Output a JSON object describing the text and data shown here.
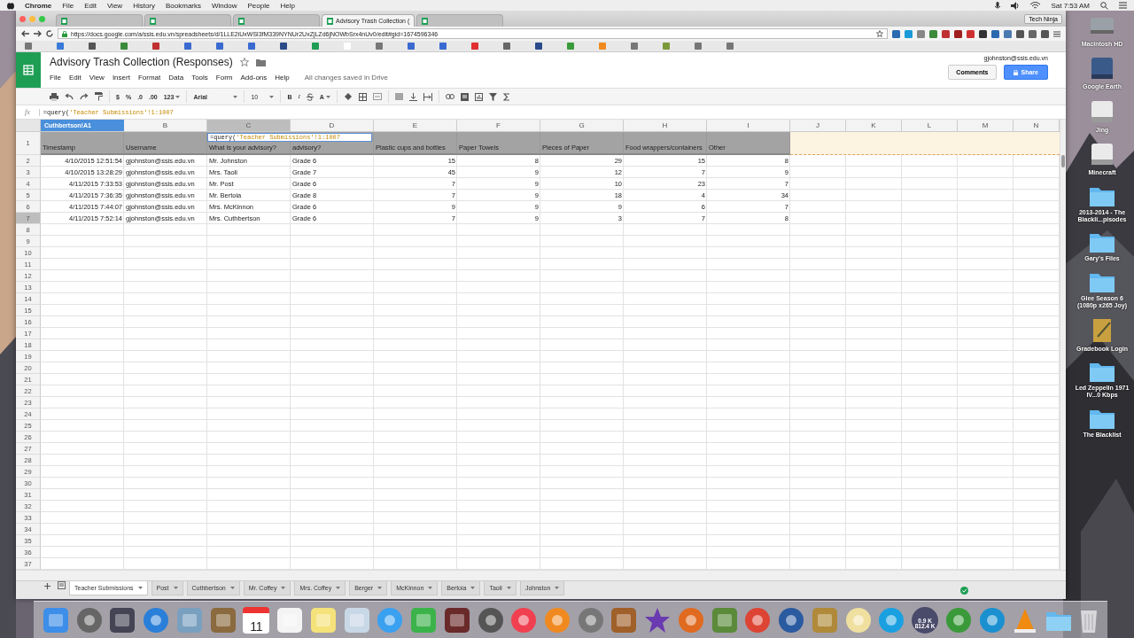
{
  "menubar": {
    "app": "Chrome",
    "menus": [
      "File",
      "Edit",
      "View",
      "History",
      "Bookmarks",
      "Window",
      "People",
      "Help"
    ],
    "clock": "Sat 7:53 AM"
  },
  "browser": {
    "tabs": [
      {
        "selected": false
      },
      {
        "selected": false
      },
      {
        "selected": false
      },
      {
        "title": "Advisory Trash Collection (",
        "selected": true
      },
      {
        "selected": false
      }
    ],
    "profile": "Tech Ninja",
    "url": "https://docs.google.com/a/ssis.edu.vn/spreadsheets/d/1LLE2iUxWSl3fM339NYNUr2UxZjLZd6jNOWbSrx4nUv0/edit#gid=1674596346"
  },
  "doc": {
    "title": "Advisory Trash Collection (Responses)",
    "menus": [
      "File",
      "Edit",
      "View",
      "Insert",
      "Format",
      "Data",
      "Tools",
      "Form",
      "Add-ons",
      "Help"
    ],
    "save_status": "All changes saved in Drive",
    "user": "gjohnston@ssis.edu.vn",
    "comments_button": "Comments",
    "share_button": "Share"
  },
  "toolbar": {
    "currency": "$",
    "percent": "%",
    "decrease_decimals": ".0",
    "increase_decimals": ".00",
    "number_format": "123",
    "font": "Arial",
    "font_size": "10",
    "bold": "B",
    "italic": "I",
    "text_color": "A"
  },
  "formula_bar": {
    "label": "fx",
    "formula_start": "=query(",
    "formula_reference": "'Teacher Submissions'!1:1007"
  },
  "name_box": "Cuthbertson!A1",
  "cell_editor": {
    "formula_start": "=query(",
    "formula_reference": "'Teacher Submissions'!1:1007"
  },
  "columns": [
    {
      "letter": "B",
      "selected": false
    },
    {
      "letter": "C",
      "selected": true
    },
    {
      "letter": "D",
      "selected": false
    },
    {
      "letter": "E",
      "selected": false
    },
    {
      "letter": "F",
      "selected": false
    },
    {
      "letter": "G",
      "selected": false
    },
    {
      "letter": "H",
      "selected": false
    },
    {
      "letter": "I",
      "selected": false
    },
    {
      "letter": "J",
      "selected": false
    },
    {
      "letter": "K",
      "selected": false
    },
    {
      "letter": "L",
      "selected": false
    },
    {
      "letter": "M",
      "selected": false
    },
    {
      "letter": "N",
      "selected": false
    }
  ],
  "header_row": {
    "number": "1",
    "selected": false,
    "cells": [
      "Timestamp",
      "Username",
      "What is your advisory?",
      "advisory?",
      "Plastic cups and bottles",
      "Paper Towels",
      "Pieces of Paper",
      "Food wrappers/containers",
      "Other"
    ]
  },
  "rows": [
    {
      "number": "2",
      "selected": false,
      "cells": [
        "4/10/2015 12:51:54",
        "gjohnston@ssis.edu.vn",
        "Mr. Johnston",
        "Grade 6",
        "15",
        "8",
        "29",
        "15",
        "8"
      ]
    },
    {
      "number": "3",
      "selected": false,
      "cells": [
        "4/10/2015 13:28:29",
        "gjohnston@ssis.edu.vn",
        "Mrs. Taoli",
        "Grade 7",
        "45",
        "9",
        "12",
        "7",
        "9"
      ]
    },
    {
      "number": "4",
      "selected": false,
      "cells": [
        "4/11/2015 7:33:53",
        "gjohnston@ssis.edu.vn",
        "Mr. Post",
        "Grade 6",
        "7",
        "9",
        "10",
        "23",
        "7"
      ]
    },
    {
      "number": "5",
      "selected": false,
      "cells": [
        "4/11/2015 7:36:35",
        "gjohnston@ssis.edu.vn",
        "Mr. Bertoia",
        "Grade 8",
        "7",
        "9",
        "18",
        "4",
        "34"
      ]
    },
    {
      "number": "6",
      "selected": false,
      "cells": [
        "4/11/2015 7:44:07",
        "gjohnston@ssis.edu.vn",
        "Mrs. McKinnon",
        "Grade 6",
        "9",
        "9",
        "9",
        "6",
        "7"
      ]
    },
    {
      "number": "7",
      "selected": true,
      "cells": [
        "4/11/2015 7:52:14",
        "gjohnston@ssis.edu.vn",
        "Mrs. Cuthbertson",
        "Grade 6",
        "7",
        "9",
        "3",
        "7",
        "8"
      ]
    },
    {
      "number": "8",
      "selected": false
    },
    {
      "number": "9",
      "selected": false
    },
    {
      "number": "10",
      "selected": false
    },
    {
      "number": "11",
      "selected": false
    },
    {
      "number": "12",
      "selected": false
    },
    {
      "number": "13",
      "selected": false
    },
    {
      "number": "14",
      "selected": false
    },
    {
      "number": "15",
      "selected": false
    },
    {
      "number": "16",
      "selected": false
    },
    {
      "number": "17",
      "selected": false
    },
    {
      "number": "18",
      "selected": false
    },
    {
      "number": "19",
      "selected": false
    },
    {
      "number": "20",
      "selected": false
    },
    {
      "number": "21",
      "selected": false
    },
    {
      "number": "22",
      "selected": false
    },
    {
      "number": "23",
      "selected": false
    },
    {
      "number": "24",
      "selected": false
    },
    {
      "number": "25",
      "selected": false
    },
    {
      "number": "26",
      "selected": false
    },
    {
      "number": "27",
      "selected": false
    },
    {
      "number": "28",
      "selected": false
    },
    {
      "number": "29",
      "selected": false
    },
    {
      "number": "30",
      "selected": false
    },
    {
      "number": "31",
      "selected": false
    },
    {
      "number": "32",
      "selected": false
    },
    {
      "number": "33",
      "selected": false
    },
    {
      "number": "34",
      "selected": false
    },
    {
      "number": "35",
      "selected": false
    },
    {
      "number": "36",
      "selected": false
    },
    {
      "number": "37",
      "selected": false
    }
  ],
  "sheet_tabs": [
    {
      "label": "Teacher Submissions",
      "selected": true
    },
    {
      "label": "Post",
      "selected": false
    },
    {
      "label": "Cuthbertson",
      "selected": false
    },
    {
      "label": "Mr. Coffey",
      "selected": false
    },
    {
      "label": "Mrs. Coffey",
      "selected": false
    },
    {
      "label": "Berger",
      "selected": false
    },
    {
      "label": "McKinnon",
      "selected": false
    },
    {
      "label": "Bertoia",
      "selected": false
    },
    {
      "label": "Taoli",
      "selected": false
    },
    {
      "label": "Johnston",
      "selected": false
    }
  ],
  "desktop_icons": [
    {
      "label": "Macintosh HD",
      "kind": "drive"
    },
    {
      "label": "Google Earth",
      "kind": "disk"
    },
    {
      "label": "Jing",
      "kind": "volume"
    },
    {
      "label": "Minecraft",
      "kind": "volume"
    },
    {
      "label": "2013-2014 - The Blackli...pisodes",
      "kind": "folder"
    },
    {
      "label": "Gary's Files",
      "kind": "folder"
    },
    {
      "label": "Glee Season 6 (1080p x265 Joy)",
      "kind": "folder"
    },
    {
      "label": "Gradebook Login",
      "kind": "document"
    },
    {
      "label": "Led Zeppelin 1971 IV...0 Kbps",
      "kind": "folder"
    },
    {
      "label": "The Blacklist",
      "kind": "folder"
    }
  ],
  "dock": {
    "calendar_day": "11",
    "network_meter": [
      "0.9 K",
      "812.4 K"
    ]
  }
}
